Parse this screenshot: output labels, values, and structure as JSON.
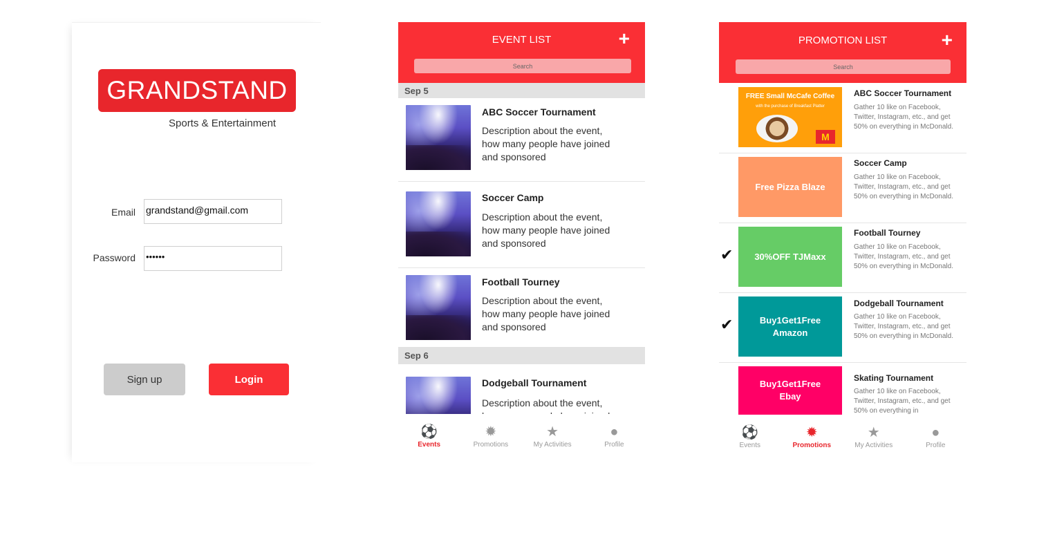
{
  "login": {
    "logo_text": "GRANDSTAND",
    "logo_sub": "Sports & Entertainment",
    "email_label": "Email",
    "email_value": "grandstand@gmail.com",
    "password_label": "Password",
    "password_value": "••••••",
    "signup_label": "Sign up",
    "login_label": "Login"
  },
  "events": {
    "title": "EVENT LIST",
    "add_icon": "+",
    "search_placeholder": "Search",
    "groups": [
      {
        "date": "Sep 5",
        "items": [
          {
            "title": "ABC Soccer Tournament",
            "desc": "Description about the event, how many people have joined and sponsored"
          },
          {
            "title": "Soccer Camp",
            "desc": "Description about the event, how many people have joined and sponsored"
          },
          {
            "title": "Football Tourney",
            "desc": "Description about the event, how many people have joined and sponsored"
          }
        ]
      },
      {
        "date": "Sep 6",
        "items": [
          {
            "title": "Dodgeball Tournament",
            "desc": "Description about the event, how many people have joined and sponsored"
          }
        ]
      }
    ]
  },
  "promotions": {
    "title": "PROMOTION LIST",
    "add_icon": "+",
    "search_placeholder": "Search",
    "items": [
      {
        "banner": "FREE Small McCafe Coffee",
        "banner_sub": "with the purchase of Breakfast Platter",
        "color": "#ff9f0a",
        "title": "ABC Soccer Tournament",
        "desc": "Gather 10 like on Facebook, Twitter, Instagram, etc., and get 50% on everything in McDonald.",
        "checked": false
      },
      {
        "banner": "Free Pizza Blaze",
        "color": "#ff9966",
        "title": "Soccer Camp",
        "desc": "Gather 10 like on Facebook, Twitter, Instagram, etc., and get 50% on everything in McDonald.",
        "checked": false
      },
      {
        "banner": "30%OFF TJMaxx",
        "color": "#66cc66",
        "title": "Football Tourney",
        "desc": "Gather 10 like on Facebook, Twitter, Instagram, etc., and get 50% on everything in McDonald.",
        "checked": true
      },
      {
        "banner": "Buy1Get1Free Amazon",
        "color": "#009999",
        "title": "Dodgeball Tournament",
        "desc": "Gather 10 like on Facebook, Twitter, Instagram, etc., and get 50% on everything in McDonald.",
        "checked": true
      },
      {
        "banner": "Buy1Get1Free Ebay",
        "color": "#ff0066",
        "title": "Skating Tournament",
        "desc": "Gather 10 like on Facebook, Twitter, Instagram, etc., and get 50% on everything in",
        "checked": false
      }
    ]
  },
  "tabs": [
    {
      "label": "Events",
      "icon": "soccer-ball-icon"
    },
    {
      "label": "Promotions",
      "icon": "badge-icon"
    },
    {
      "label": "My Activities",
      "icon": "star-icon"
    },
    {
      "label": "Profile",
      "icon": "person-icon"
    }
  ],
  "colors": {
    "accent": "#fa2f35",
    "brand": "#e8262c",
    "inactive": "#999999"
  }
}
